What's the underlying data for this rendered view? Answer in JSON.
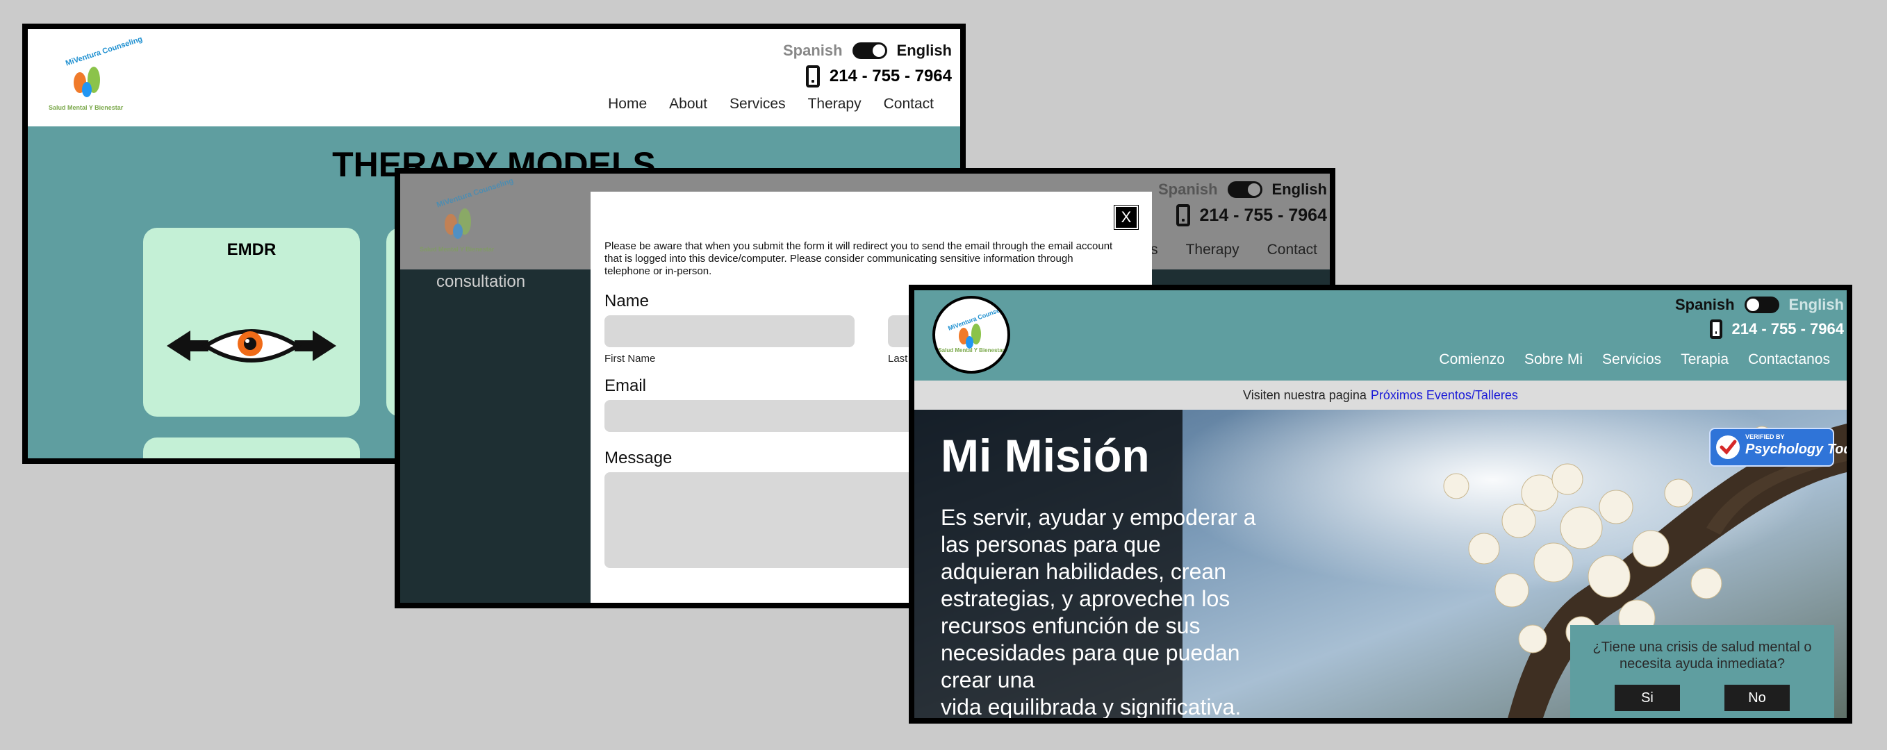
{
  "shared": {
    "lang_spanish": "Spanish",
    "lang_english": "English",
    "phone": "214 - 755 - 7964",
    "logo_arc": "MiVentura Counseling",
    "logo_sub": "Salud Mental Y Bienestar"
  },
  "page1": {
    "nav": [
      "Home",
      "About",
      "Services",
      "Therapy",
      "Contact"
    ],
    "title": "THERAPY MODELS",
    "card_emdr": "EMDR"
  },
  "page2": {
    "nav_partial": [
      "s",
      "Therapy",
      "Contact"
    ],
    "consultation": "consultation",
    "modal": {
      "close": "X",
      "note": "Please be aware that when you submit the form it will redirect you to send the email through the email account that is logged into this device/computer. Please consider communicating sensitive information through telephone or in-person.",
      "name_label": "Name",
      "first_name": "First Name",
      "last_name": "Last N",
      "email_label": "Email",
      "message_label": "Message"
    }
  },
  "page3": {
    "nav": [
      "Comienzo",
      "Sobre Mi",
      "Servicios",
      "Terapia",
      "Contactanos"
    ],
    "banner_text": "Visiten nuestra pagina",
    "banner_link": "Próximos Eventos/Talleres",
    "hero_title": "Mi Misión",
    "hero_lines": [
      "Es servir, ayudar y empoderar a",
      "las personas para que",
      "adquieran habilidades, crean",
      "estrategias, y aprovechen los",
      "recursos enfunción de sus",
      "necesidades para que puedan",
      "crear una",
      "vida equilibrada y significativa."
    ],
    "badge_small": "VERIFIED BY",
    "badge_big": "Psychology Today",
    "crisis_question": "¿Tiene una crisis de salud mental o necesita ayuda inmediata?",
    "crisis_yes": "Si",
    "crisis_no": "No"
  }
}
